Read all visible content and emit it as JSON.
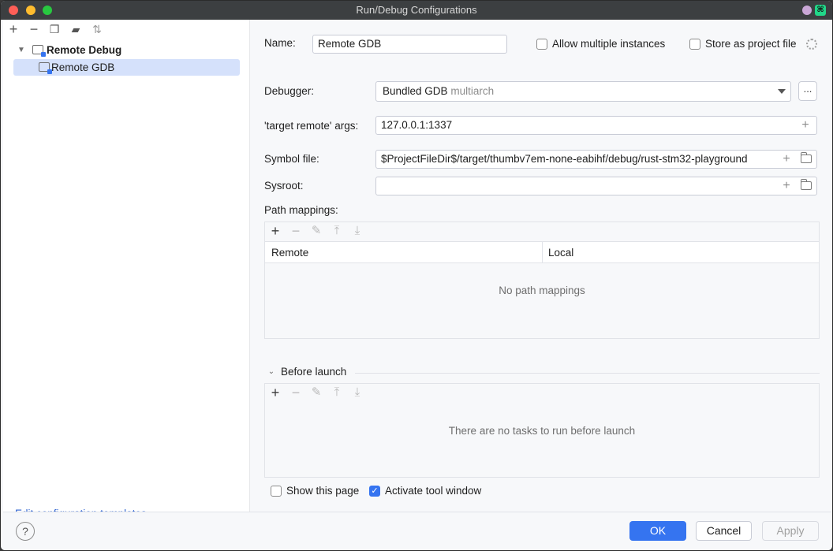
{
  "window": {
    "title": "Run/Debug Configurations"
  },
  "left_toolbar": {
    "icons": [
      "add-icon",
      "remove-icon",
      "copy-icon",
      "folder-add-icon",
      "sort-icon"
    ]
  },
  "tree": {
    "parent_label": "Remote Debug",
    "child_label": "Remote GDB"
  },
  "edit_templates_label": "Edit configuration templates...",
  "form": {
    "name_label": "Name:",
    "name_value": "Remote GDB",
    "allow_multiple_label": "Allow multiple instances",
    "store_project_label": "Store as project file",
    "debugger_label": "Debugger:",
    "debugger_value": "Bundled GDB",
    "debugger_suffix": "multiarch",
    "more_button_label": "...",
    "target_remote_label": "'target remote' args:",
    "target_remote_value": "127.0.0.1:1337",
    "symbol_file_label": "Symbol file:",
    "symbol_file_value": "$ProjectFileDir$/target/thumbv7em-none-eabihf/debug/rust-stm32-playground",
    "sysroot_label": "Sysroot:",
    "sysroot_value": ""
  },
  "path_mappings": {
    "title": "Path mappings:",
    "columns": [
      "Remote",
      "Local"
    ],
    "empty_text": "No path mappings"
  },
  "before_launch": {
    "title": "Before launch",
    "empty_text": "There are no tasks to run before launch"
  },
  "options": {
    "show_page_label": "Show this page",
    "show_page_checked": false,
    "activate_tool_window_label": "Activate tool window",
    "activate_tool_window_checked": true
  },
  "buttons": {
    "help_label": "?",
    "ok_label": "OK",
    "cancel_label": "Cancel",
    "apply_label": "Apply"
  },
  "colors": {
    "accent": "#3574f0",
    "selection": "#d5e1fb",
    "link": "#2f64d1"
  }
}
